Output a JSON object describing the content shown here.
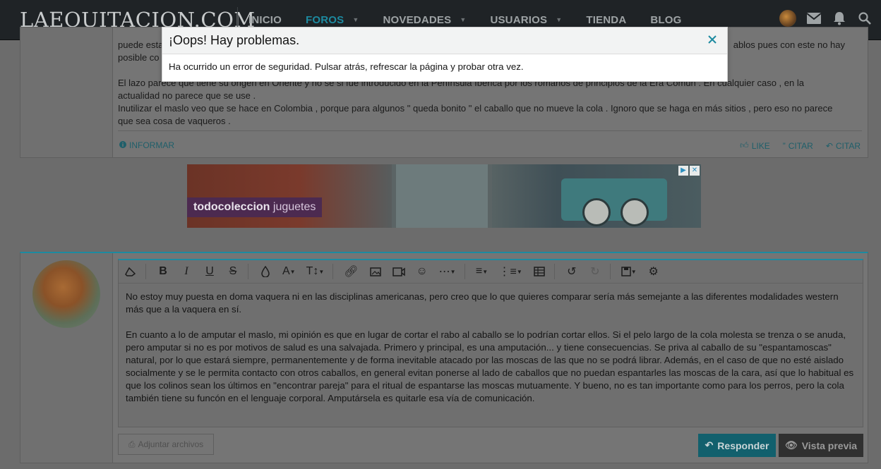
{
  "header": {
    "logo": "LAEQUITACION.COM",
    "nav": [
      {
        "label": "INICIO",
        "dropdown": false,
        "active": false
      },
      {
        "label": "FOROS",
        "dropdown": true,
        "active": true
      },
      {
        "label": "NOVEDADES",
        "dropdown": true,
        "active": false
      },
      {
        "label": "USUARIOS",
        "dropdown": true,
        "active": false
      },
      {
        "label": "TIENDA",
        "dropdown": false,
        "active": false
      },
      {
        "label": "BLOG",
        "dropdown": false,
        "active": false
      }
    ],
    "right_icons": [
      "user-avatar",
      "mail-icon",
      "bell-icon",
      "search-icon"
    ]
  },
  "previous_post": {
    "line1_left": "puede esta",
    "line1_right": "ablos pues con este no hay",
    "line2_left": "posible co",
    "paragraph2": "El lazo parece que tiene su origen en Oriente y no se si fue introducido en la Península Ibérica por los romanos de principios de la Era Común . En cualquier caso , en la actualidad no parece que se use .",
    "paragraph3": "Inutilizar el maslo veo que se hace en Colombia , porque para algunos \" queda bonito \" el caballo que no mueve la cola . Ignoro que se haga en más sitios , pero eso no parece que sea cosa de vaqueros .",
    "report_label": "INFORMAR",
    "like_label": "LIKE",
    "quote_label": "CITAR",
    "reply_label": "CITAR"
  },
  "ad": {
    "brand_bold": "todocoleccion",
    "brand_light": "juguetes",
    "adchoice_icons": [
      "adchoices-icon",
      "close-icon"
    ]
  },
  "reply_editor": {
    "toolbar": [
      "eraser-icon",
      "bold-icon",
      "italic-icon",
      "underline-icon",
      "strikethrough-icon",
      "color-drop-icon",
      "font-family-icon",
      "font-size-icon",
      "link-icon",
      "image-icon",
      "media-icon",
      "smilie-icon",
      "more-icon",
      "align-icon",
      "list-icon",
      "table-icon",
      "undo-icon",
      "redo-icon",
      "drafts-icon",
      "settings-icon"
    ],
    "paragraph1": "No estoy muy puesta en doma vaquera ni en las disciplinas americanas, pero creo que lo que quieres comparar sería más semejante a las diferentes modalidades western más que a la vaquera en sí.",
    "paragraph2": "En cuanto a lo de amputar el maslo, mi opinión es que en lugar de cortar el rabo al caballo se lo podrían cortar ellos. Si el pelo largo de la cola molesta se trenza o se anuda, pero amputar si no es por motivos de salud es una salvajada. Primero y principal, es una amputación... y tiene consecuencias. Se priva al caballo de su \"espantamoscas\" natural, por lo que estará siempre, permanentemente y de forma inevitable atacado por las moscas de las que no se podrá librar. Además, en el caso de que no esté aislado socialmente y se le permita contacto con otros caballos, en general evitan ponerse al lado de caballos que no puedan espantarles las moscas de la cara, así que lo habitual es que los colinos sean los últimos en \"encontrar pareja\" para el ritual de espantarse las moscas mutuamente. Y bueno, no es tan importante como para los perros, pero la cola también tiene su funcón en el lenguaje corporal. Amputársela es quitarle esa vía de comunicación.",
    "attach_label": "Adjuntar archivos",
    "reply_button": "Responder",
    "preview_button": "Vista previa"
  },
  "modal": {
    "title": "¡Oops! Hay problemas.",
    "message": "Ha ocurrido un error de seguridad. Pulsar atrás, refrescar la página y probar otra vez."
  }
}
